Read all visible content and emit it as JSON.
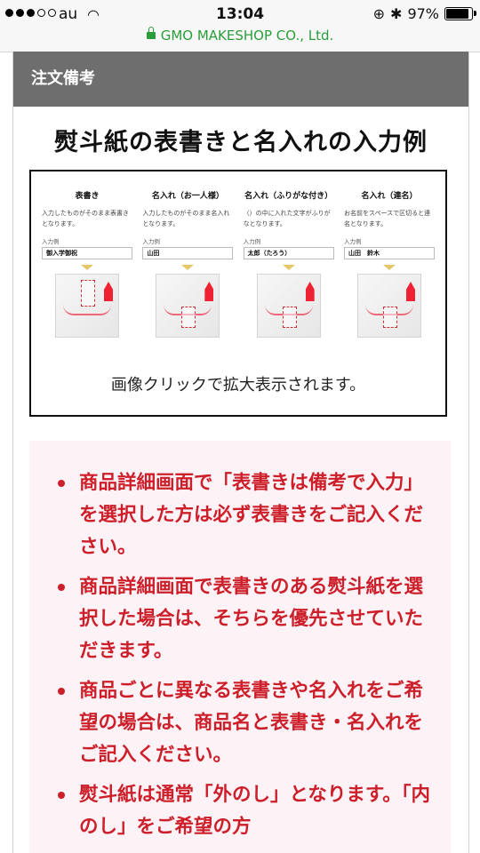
{
  "status_bar": {
    "carrier": "au",
    "time": "13:04",
    "battery": "97%",
    "battery_level": 0.97,
    "url": "GMO MAKESHOP CO., Ltd."
  },
  "section": {
    "header": "注文備考",
    "heading": "熨斗紙の表書きと名入れの入力例"
  },
  "example": {
    "columns": [
      {
        "title": "表書き",
        "desc": "入力したものがそのまま表書きとなります。",
        "input_label": "入力例",
        "input_value": "御入学御祝"
      },
      {
        "title": "名入れ（お一人様）",
        "desc": "入力したものがそのまま名入れとなります。",
        "input_label": "入力例",
        "input_value": "山田"
      },
      {
        "title": "名入れ（ふりがな付き）",
        "desc": "（）の中に入れた文字がふりがなとなります。",
        "input_label": "入力例",
        "input_value": "太郎（たろう）"
      },
      {
        "title": "名入れ（連名）",
        "desc": "お名前をスペースで区切ると連名となります。",
        "input_label": "入力例",
        "input_value": "山田　鈴木"
      }
    ],
    "caption": "画像クリックで拡大表示されます。"
  },
  "notes": [
    "商品詳細画面で「表書きは備考で入力」を選択した方は必ず表書きをご記入ください。",
    "商品詳細画面で表書きのある熨斗紙を選択した場合は、そちらを優先させていただきます。",
    "商品ごとに異なる表書きや名入れをご希望の場合は、商品名と表書き・名入れをご記入ください。",
    "熨斗紙は通常「外のし」となります。「内のし」をご希望の方"
  ]
}
